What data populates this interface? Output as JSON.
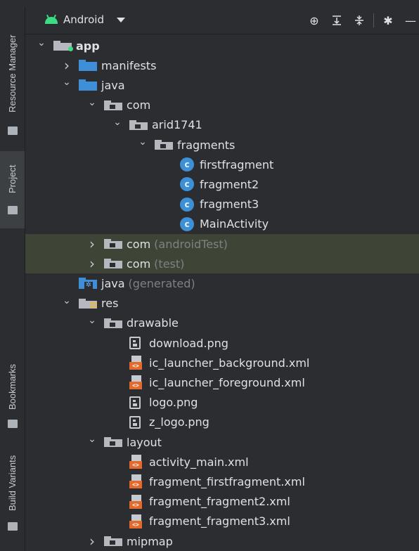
{
  "top_path": "",
  "side_tabs": [
    {
      "label": "Resource Manager",
      "active": false
    },
    {
      "label": "Project",
      "active": true
    },
    {
      "label": "Bookmarks",
      "active": false
    },
    {
      "label": "Build Variants",
      "active": false
    }
  ],
  "toolbar": {
    "view_mode": "Android",
    "icons": [
      "locate-icon",
      "expand-all-icon",
      "collapse-all-icon",
      "gear-icon",
      "minimize-icon"
    ]
  },
  "tree": [
    {
      "label": "app",
      "bold": true,
      "icon": "folder-module-icon",
      "arrow": "expanded",
      "level": 0
    },
    {
      "label": "manifests",
      "icon": "folder-blue-icon",
      "arrow": "collapsed",
      "level": 1
    },
    {
      "label": "java",
      "icon": "folder-blue-icon",
      "arrow": "expanded",
      "level": 1
    },
    {
      "label": "com",
      "icon": "package-icon",
      "arrow": "expanded",
      "level": 2
    },
    {
      "label": "arid1741",
      "icon": "package-icon",
      "arrow": "expanded",
      "level": 3
    },
    {
      "label": "fragments",
      "icon": "package-icon",
      "arrow": "expanded",
      "level": 4
    },
    {
      "label": "firstfragment",
      "icon": "class-icon",
      "arrow": "none",
      "level": 5
    },
    {
      "label": "fragment2",
      "icon": "class-icon",
      "arrow": "none",
      "level": 5
    },
    {
      "label": "fragment3",
      "icon": "class-icon",
      "arrow": "none",
      "level": 5
    },
    {
      "label": "MainActivity",
      "icon": "class-icon",
      "arrow": "none",
      "level": 5
    },
    {
      "label": "com",
      "suffix": "(androidTest)",
      "icon": "package-icon",
      "arrow": "collapsed",
      "level": 2,
      "highlight": true
    },
    {
      "label": "com",
      "suffix": "(test)",
      "icon": "package-icon",
      "arrow": "collapsed",
      "level": 2,
      "highlight": true
    },
    {
      "label": "java",
      "suffix": "(generated)",
      "icon": "generated-folder-icon",
      "arrow": "none",
      "level": 1
    },
    {
      "label": "res",
      "icon": "res-folder-icon",
      "arrow": "expanded",
      "level": 1
    },
    {
      "label": "drawable",
      "icon": "package-icon",
      "arrow": "expanded",
      "level": 2
    },
    {
      "label": "download.png",
      "icon": "image-file-icon",
      "arrow": "none",
      "level": 3
    },
    {
      "label": "ic_launcher_background.xml",
      "icon": "xml-file-icon",
      "arrow": "none",
      "level": 3
    },
    {
      "label": "ic_launcher_foreground.xml",
      "icon": "xml-file-icon",
      "arrow": "none",
      "level": 3
    },
    {
      "label": "logo.png",
      "icon": "image-file-icon",
      "arrow": "none",
      "level": 3
    },
    {
      "label": "z_logo.png",
      "icon": "image-file-icon",
      "arrow": "none",
      "level": 3
    },
    {
      "label": "layout",
      "icon": "package-icon",
      "arrow": "expanded",
      "level": 2
    },
    {
      "label": "activity_main.xml",
      "icon": "xml-file-icon",
      "arrow": "none",
      "level": 3
    },
    {
      "label": "fragment_firstfragment.xml",
      "icon": "xml-file-icon",
      "arrow": "none",
      "level": 3
    },
    {
      "label": "fragment_fragment2.xml",
      "icon": "xml-file-icon",
      "arrow": "none",
      "level": 3
    },
    {
      "label": "fragment_fragment3.xml",
      "icon": "xml-file-icon",
      "arrow": "none",
      "level": 3
    },
    {
      "label": "mipmap",
      "icon": "package-icon",
      "arrow": "collapsed",
      "level": 2
    }
  ],
  "colors": {
    "background": "#2b2d30",
    "highlight_row": "#3e4537",
    "folder_blue": "#3f8ed8",
    "class_icon": "#3d8fd6",
    "android_green": "#3ddc84",
    "xml_tag": "#e36a2c"
  }
}
